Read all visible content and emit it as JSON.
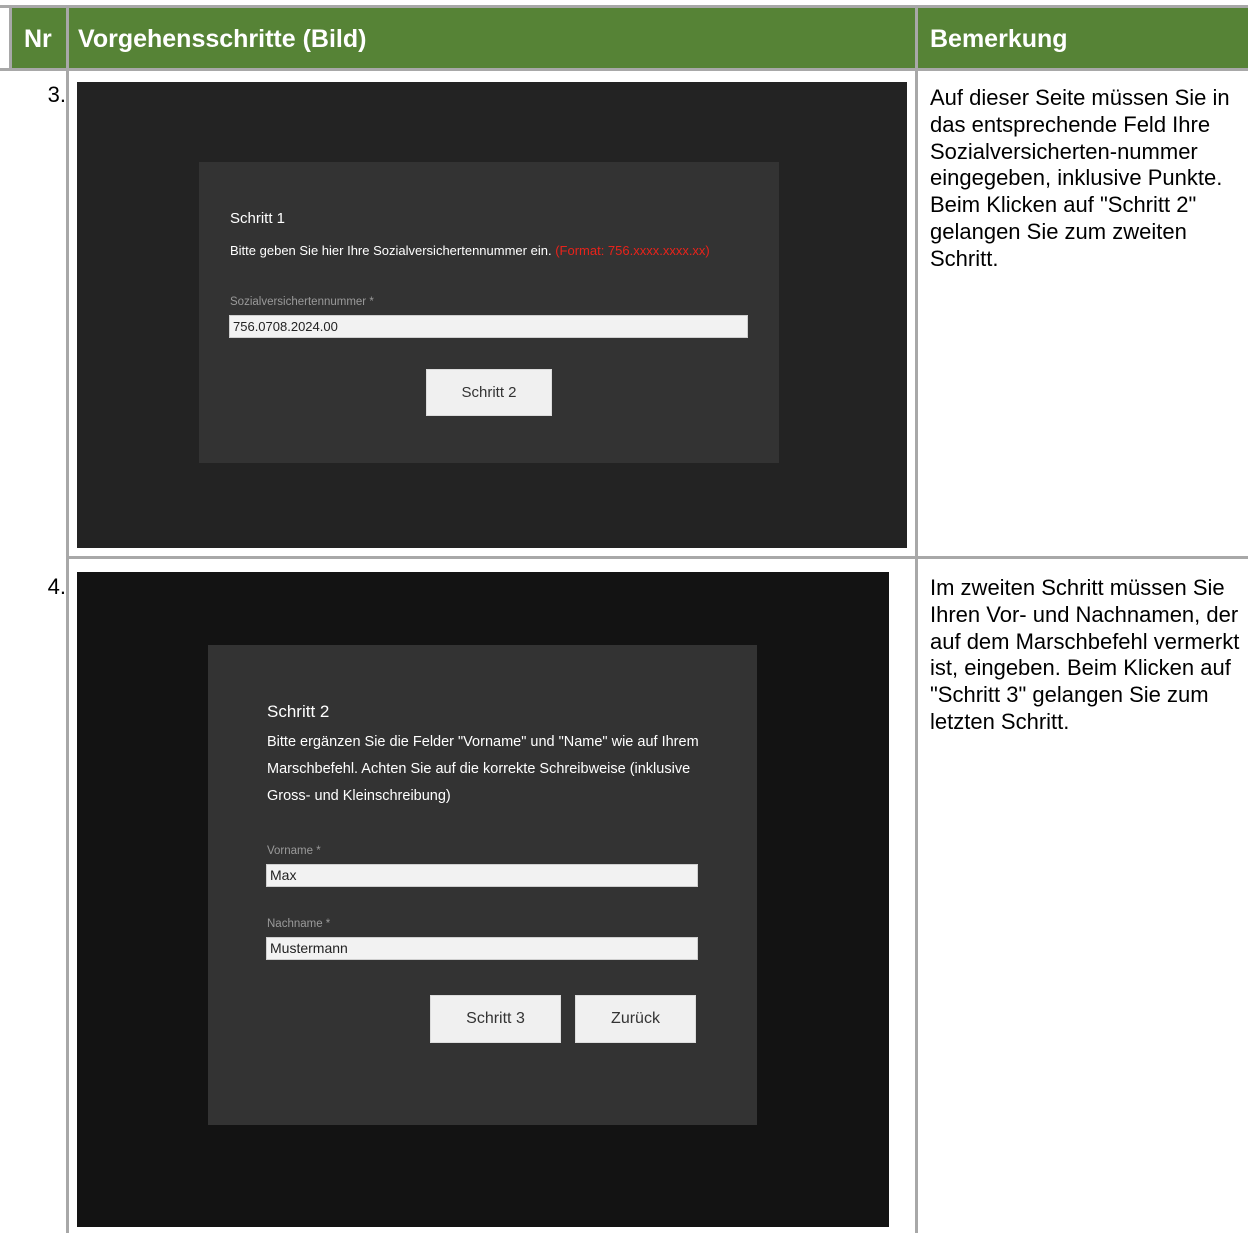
{
  "header": {
    "nr": "Nr",
    "steps": "Vorgehensschritte (Bild)",
    "note": "Bemerkung"
  },
  "rows": [
    {
      "nr": "3.",
      "screenshot": {
        "step_title": "Schritt 1",
        "instruction": "Bitte geben Sie hier Ihre Sozialversichertennummer ein.",
        "format_hint": "(Format: 756.xxxx.xxxx.xx)",
        "field_label": "Sozialversichertennummer *",
        "field_value": "756.0708.2024.00",
        "button": "Schritt 2"
      },
      "note": "Auf dieser Seite müssen Sie in das entsprechende Feld Ihre Sozialversicherten-nummer eingegeben, inklusive Punkte. Beim Klicken auf \"Schritt 2\" gelangen Sie zum zweiten Schritt."
    },
    {
      "nr": "4.",
      "screenshot": {
        "step_title": "Schritt 2",
        "instruction": "Bitte ergänzen Sie die Felder \"Vorname\" und \"Name\" wie auf Ihrem Marschbefehl. Achten Sie auf die korrekte Schreibweise (inklusive Gross- und Kleinschreibung)",
        "first_name_label": "Vorname *",
        "first_name_value": "Max",
        "last_name_label": "Nachname *",
        "last_name_value": "Mustermann",
        "next_button": "Schritt 3",
        "back_button": "Zurück"
      },
      "note": "Im zweiten Schritt müssen Sie Ihren Vor- und Nachnamen, der auf dem Marschbefehl vermerkt ist, eingeben. Beim Klicken auf \"Schritt 3\" gelangen Sie zum letzten Schritt."
    }
  ],
  "colors": {
    "header_bg": "#568336",
    "grid": "#a8a8a8",
    "format_hint": "#e8231b"
  }
}
